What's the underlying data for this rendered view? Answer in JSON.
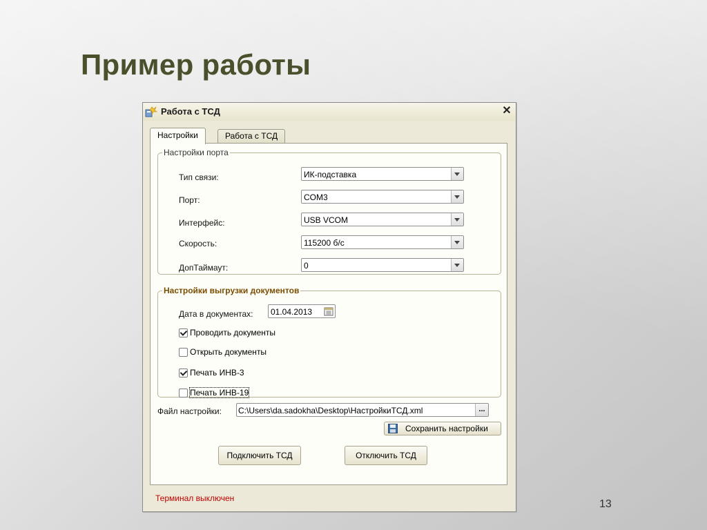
{
  "slide": {
    "title": "Пример работы",
    "page_number": "13"
  },
  "dialog": {
    "title": "Работа с ТСД",
    "close_glyph": "✕",
    "tabs": [
      {
        "label": "Настройки",
        "active": true
      },
      {
        "label": "Работа с ТСД",
        "active": false
      }
    ],
    "port_settings": {
      "legend": "Настройки порта",
      "fields": [
        {
          "label": "Тип связи:",
          "value": "ИК-подставка"
        },
        {
          "label": "Порт:",
          "value": "COM3"
        },
        {
          "label": "Интерфейс:",
          "value": "USB VCOM"
        },
        {
          "label": "Скорость:",
          "value": "115200 б/с"
        },
        {
          "label": "ДопТаймаут:",
          "value": "0"
        }
      ]
    },
    "upload_settings": {
      "legend": "Настройки выгрузки документов",
      "date_label": "Дата в документах:",
      "date_value": "01.04.2013",
      "checkboxes": [
        {
          "label": "Проводить документы",
          "checked": true
        },
        {
          "label": "Открыть документы",
          "checked": false
        },
        {
          "label": "Печать ИНВ-3",
          "checked": true
        },
        {
          "label": "Печать ИНВ-19",
          "checked": false
        }
      ]
    },
    "file": {
      "label": "Файл настройки:",
      "value": "C:\\Users\\da.sadokha\\Desktop\\НастройкиТСД.xml",
      "browse_glyph": "..."
    },
    "save_button": "Сохранить настройки",
    "connect_button": "Подключить ТСД",
    "disconnect_button": "Отключить ТСД",
    "status": "Терминал выключен",
    "colors": {
      "title_text": "#4a4f2c",
      "status_text": "#c00000",
      "group_legend_bold": "#7a4d00",
      "dialog_bg": "#ece9d8"
    }
  }
}
